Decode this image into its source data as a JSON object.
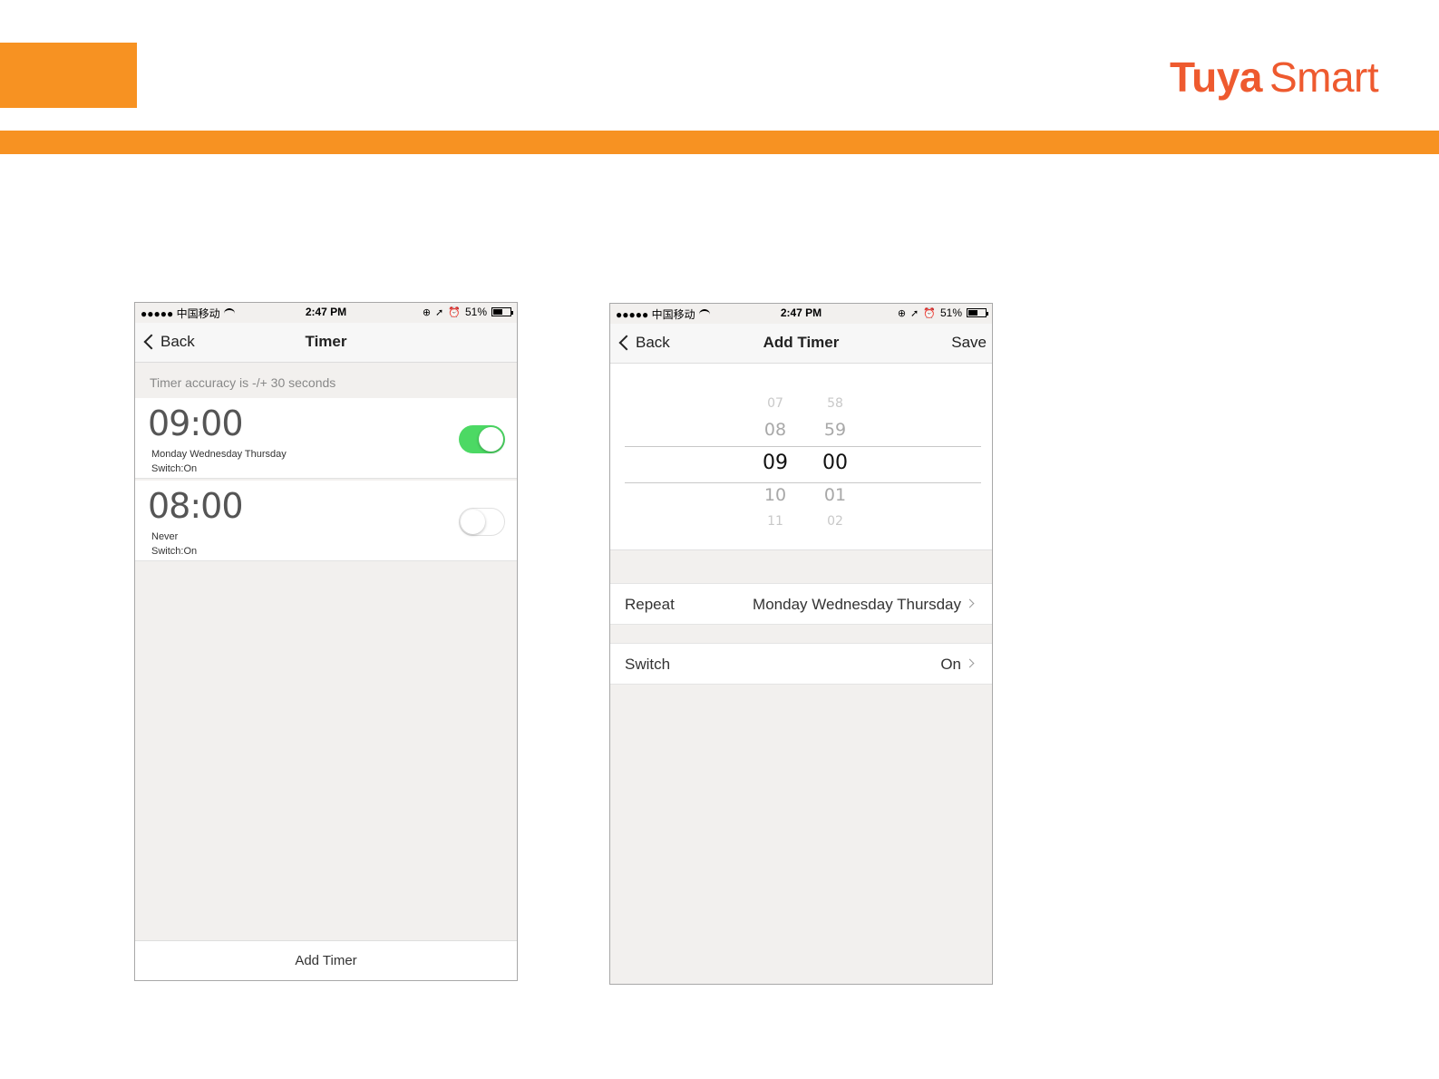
{
  "brand": {
    "part1": "Tuya",
    "part2": "Smart",
    "color": "#ee5a2f",
    "accent": "#f79222"
  },
  "status": {
    "carrier": "●●●●● 中国移动",
    "time": "2:47 PM",
    "battery": "51%"
  },
  "timer_screen": {
    "back_label": "Back",
    "title": "Timer",
    "note": "Timer accuracy is -/+ 30 seconds",
    "timers": [
      {
        "time": "09:00",
        "days": "Monday Wednesday Thursday",
        "switch": "Switch:On",
        "enabled": true
      },
      {
        "time": "08:00",
        "days": "Never",
        "switch": "Switch:On",
        "enabled": false
      }
    ],
    "add_button": "Add Timer",
    "toggle_on_color": "#4cd964"
  },
  "add_screen": {
    "back_label": "Back",
    "title": "Add Timer",
    "save_label": "Save",
    "picker": {
      "hours": [
        "07",
        "08",
        "09",
        "10",
        "11"
      ],
      "minutes": [
        "58",
        "59",
        "00",
        "01",
        "02"
      ],
      "selected_hour": "09",
      "selected_minute": "00"
    },
    "repeat": {
      "label": "Repeat",
      "value": "Monday Wednesday Thursday"
    },
    "switch": {
      "label": "Switch",
      "value": "On"
    }
  }
}
